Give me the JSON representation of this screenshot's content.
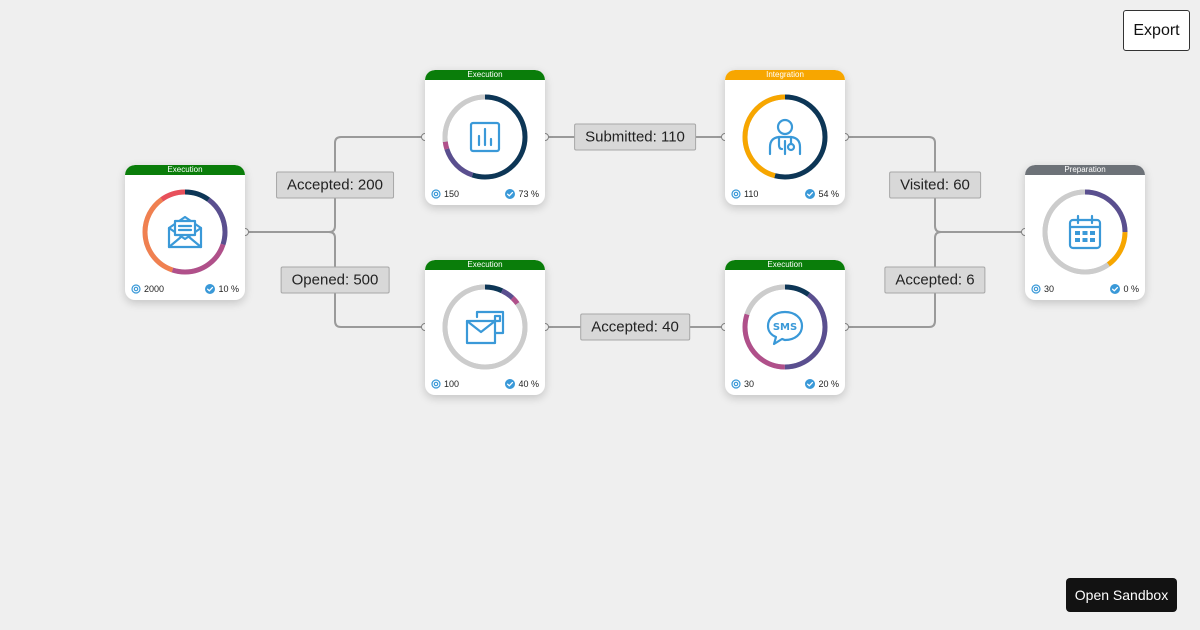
{
  "toolbar": {
    "export_label": "Export"
  },
  "footer": {
    "sandbox_label": "Open Sandbox"
  },
  "colors": {
    "execution": "#0a7d0a",
    "integration": "#f7a600",
    "preparation": "#6d7278",
    "icon": "#3a99d8",
    "ring_track": "#cccccc",
    "dark_blue": "#0d3656",
    "purple": "#5a4f8f",
    "magenta": "#b0508a",
    "orange": "#f08050",
    "red": "#e8505b",
    "amber": "#f7a600",
    "edge": "#9a9a9a"
  },
  "nodes": [
    {
      "id": "email",
      "header": "Execution",
      "status": "execution",
      "icon": "envelope-open-icon",
      "count": "2000",
      "percent": "10 %",
      "ring": [
        {
          "color": "dark_blue",
          "value": 10
        },
        {
          "color": "purple",
          "value": 20
        },
        {
          "color": "magenta",
          "value": 25
        },
        {
          "color": "orange",
          "value": 35
        },
        {
          "color": "red",
          "value": 10
        }
      ]
    },
    {
      "id": "survey",
      "header": "Execution",
      "status": "execution",
      "icon": "bar-chart-icon",
      "count": "150",
      "percent": "73 %",
      "ring": [
        {
          "color": "dark_blue",
          "value": 55
        },
        {
          "color": "purple",
          "value": 15
        },
        {
          "color": "magenta",
          "value": 3
        },
        {
          "color": "ring_track",
          "value": 27
        }
      ]
    },
    {
      "id": "mail",
      "header": "Execution",
      "status": "execution",
      "icon": "direct-mail-icon",
      "count": "100",
      "percent": "40 %",
      "ring": [
        {
          "color": "dark_blue",
          "value": 7
        },
        {
          "color": "purple",
          "value": 5
        },
        {
          "color": "magenta",
          "value": 3
        },
        {
          "color": "ring_track",
          "value": 85
        }
      ]
    },
    {
      "id": "doctor",
      "header": "Integration",
      "status": "integration",
      "icon": "doctor-icon",
      "count": "110",
      "percent": "54 %",
      "ring": [
        {
          "color": "dark_blue",
          "value": 54
        },
        {
          "color": "amber",
          "value": 46
        }
      ]
    },
    {
      "id": "sms",
      "header": "Execution",
      "status": "execution",
      "icon": "sms-icon",
      "count": "30",
      "percent": "20 %",
      "ring": [
        {
          "color": "dark_blue",
          "value": 10
        },
        {
          "color": "purple",
          "value": 40
        },
        {
          "color": "magenta",
          "value": 30
        },
        {
          "color": "ring_track",
          "value": 20
        }
      ]
    },
    {
      "id": "calendar",
      "header": "Preparation",
      "status": "preparation",
      "icon": "calendar-icon",
      "count": "30",
      "percent": "0 %",
      "ring": [
        {
          "color": "purple",
          "value": 25
        },
        {
          "color": "amber",
          "value": 15
        },
        {
          "color": "ring_track",
          "value": 60
        }
      ]
    }
  ],
  "edges": [
    {
      "from": "email",
      "to": "survey",
      "label": "Accepted: 200"
    },
    {
      "from": "email",
      "to": "mail",
      "label": "Opened: 500"
    },
    {
      "from": "survey",
      "to": "doctor",
      "label": "Submitted: 110"
    },
    {
      "from": "mail",
      "to": "sms",
      "label": "Accepted: 40"
    },
    {
      "from": "doctor",
      "to": "calendar",
      "label": "Visited: 60"
    },
    {
      "from": "sms",
      "to": "calendar",
      "label": "Accepted: 6"
    }
  ]
}
